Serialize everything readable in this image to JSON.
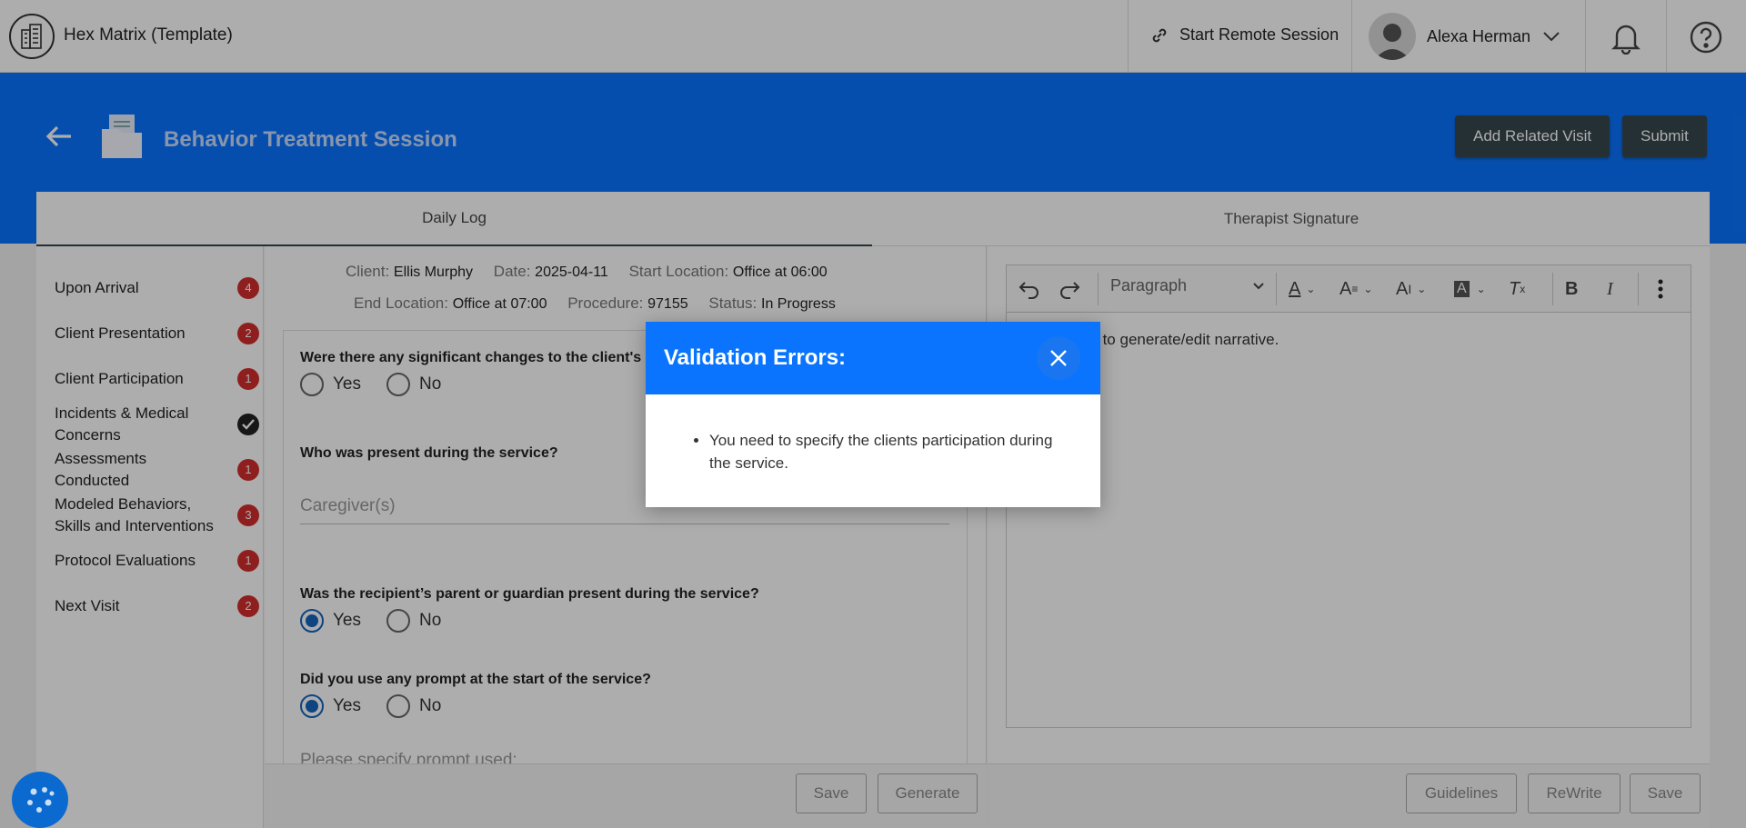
{
  "app": {
    "title": "Hex Matrix (Template)"
  },
  "topbar": {
    "remote_label": "Start Remote Session",
    "user_name": "Alexa Herman"
  },
  "header": {
    "page_title": "Behavior Treatment Session",
    "add_related_label": "Add Related Visit",
    "submit_label": "Submit"
  },
  "tabs": [
    {
      "label": "Daily Log",
      "active": true
    },
    {
      "label": "Therapist Signature",
      "active": false
    }
  ],
  "sidebar": {
    "items": [
      {
        "label": "Upon Arrival",
        "badge": "4"
      },
      {
        "label": "Client Presentation",
        "badge": "2"
      },
      {
        "label": "Client Participation",
        "badge": "1"
      },
      {
        "label": "Incidents & Medical Concerns",
        "badge": "check"
      },
      {
        "label": "Assessments Conducted",
        "badge": "1"
      },
      {
        "label": "Modeled Behaviors, Skills and Interventions",
        "badge": "3"
      },
      {
        "label": "Protocol Evaluations",
        "badge": "1"
      },
      {
        "label": "Next Visit",
        "badge": "2"
      }
    ]
  },
  "session": {
    "client_label": "Client:",
    "client": "Ellis Murphy",
    "date_label": "Date:",
    "date": "2025-04-11",
    "start_label": "Start Location:",
    "start": "Office at 06:00",
    "end_label": "End Location:",
    "end": "Office at 07:00",
    "procedure_label": "Procedure:",
    "procedure": "97155",
    "status_label": "Status:",
    "status": "In Progress"
  },
  "form": {
    "q1": "Were there any significant changes to the client's",
    "q2": "Who was present during the service?",
    "q2_placeholder": "Caregiver(s)",
    "q3": "Was the recipient’s parent or guardian present during the service?",
    "q4": "Did you use any prompt at the start of the service?",
    "q4_placeholder": "Please specify prompt used:",
    "yes": "Yes",
    "no": "No",
    "save_label": "Save",
    "generate_label": "Generate"
  },
  "editor": {
    "paragraph_label": "Paragraph",
    "text": "l sections to generate/edit narrative.",
    "guidelines_label": "Guidelines",
    "rewrite_label": "ReWrite",
    "save_label": "Save"
  },
  "modal": {
    "title": "Validation Errors:",
    "errors": [
      "You need to specify the clients participation during the service."
    ]
  },
  "colors": {
    "brand_blue": "#0a74ff",
    "badge_red": "#d32f2f",
    "dark_button": "#37474f"
  }
}
